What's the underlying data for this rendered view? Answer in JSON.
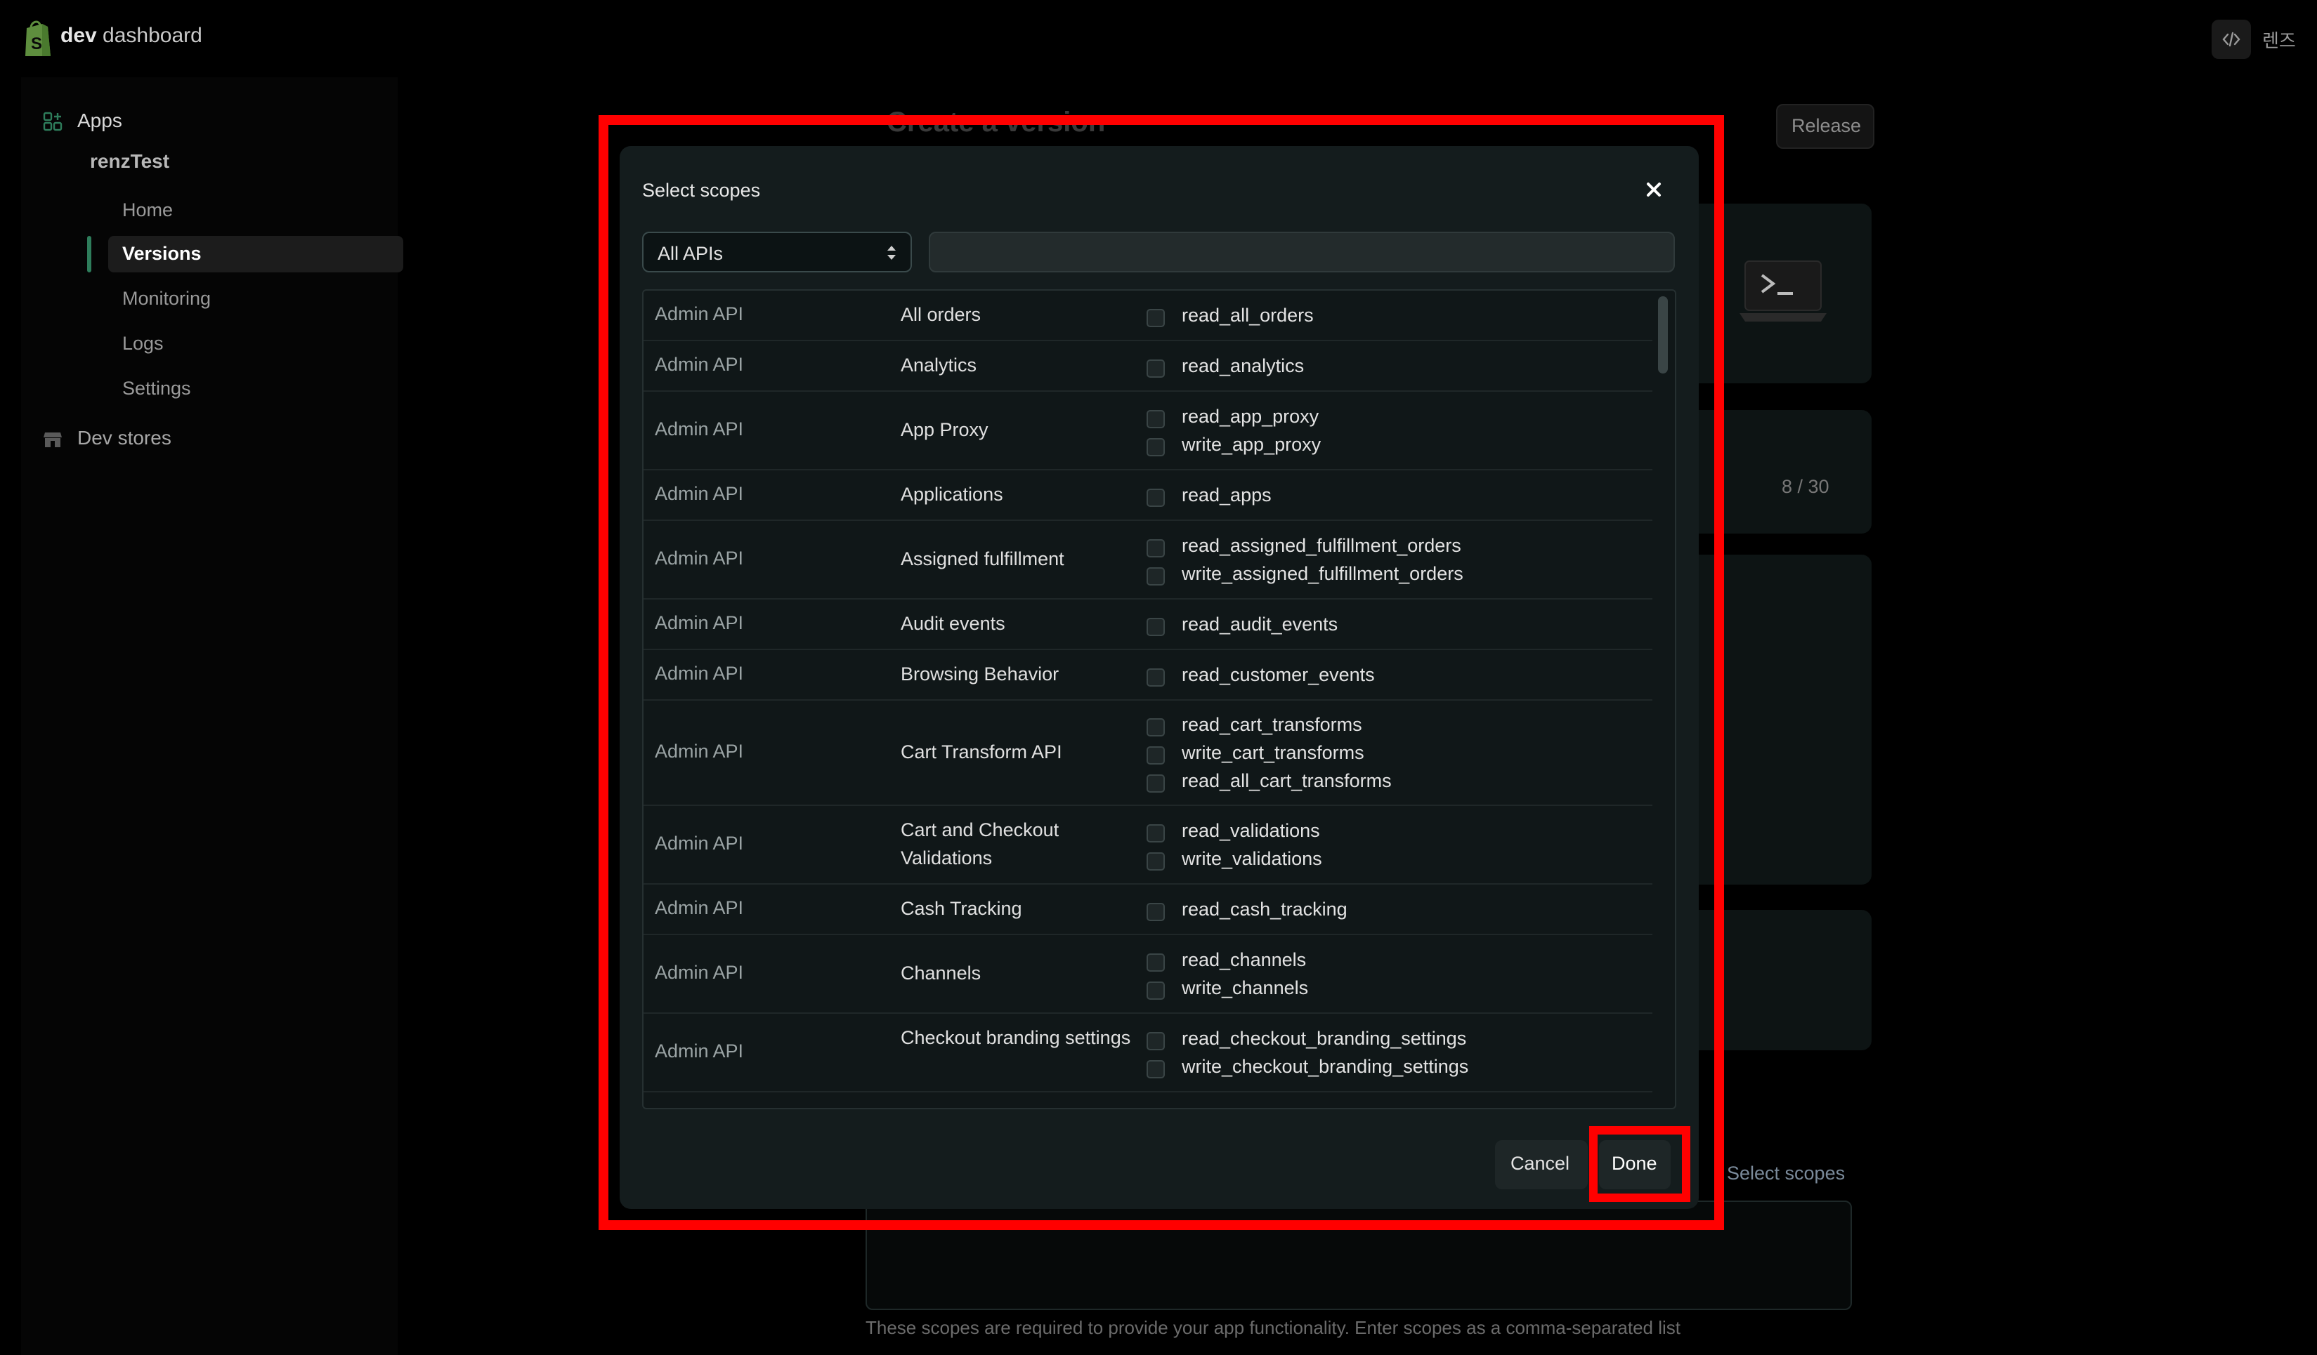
{
  "header": {
    "brand_bold": "dev",
    "brand_rest": "dashboard",
    "user": "렌즈"
  },
  "sidebar": {
    "apps_label": "Apps",
    "app_name": "renzTest",
    "items": [
      {
        "label": "Home"
      },
      {
        "label": "Versions"
      },
      {
        "label": "Monitoring"
      },
      {
        "label": "Logs"
      },
      {
        "label": "Settings"
      }
    ],
    "dev_stores_label": "Dev stores"
  },
  "page": {
    "title": "Create a version",
    "release_label": "Release",
    "counter": "8 / 30",
    "select_scopes_link": "Select scopes",
    "help_text": "These scopes are required to provide your app functionality. Enter scopes as a comma-separated list"
  },
  "modal": {
    "title": "Select scopes",
    "api_filter": "All APIs",
    "search_value": "",
    "cancel_label": "Cancel",
    "done_label": "Done",
    "rows": [
      {
        "api": "Admin API",
        "name": "All orders",
        "scopes": [
          "read_all_orders"
        ]
      },
      {
        "api": "Admin API",
        "name": "Analytics",
        "scopes": [
          "read_analytics"
        ]
      },
      {
        "api": "Admin API",
        "name": "App Proxy",
        "scopes": [
          "read_app_proxy",
          "write_app_proxy"
        ]
      },
      {
        "api": "Admin API",
        "name": "Applications",
        "scopes": [
          "read_apps"
        ]
      },
      {
        "api": "Admin API",
        "name": "Assigned fulfillment",
        "scopes": [
          "read_assigned_fulfillment_orders",
          "write_assigned_fulfillment_orders"
        ]
      },
      {
        "api": "Admin API",
        "name": "Audit events",
        "scopes": [
          "read_audit_events"
        ]
      },
      {
        "api": "Admin API",
        "name": "Browsing Behavior",
        "scopes": [
          "read_customer_events"
        ]
      },
      {
        "api": "Admin API",
        "name": "Cart Transform API",
        "scopes": [
          "read_cart_transforms",
          "write_cart_transforms",
          "read_all_cart_transforms"
        ]
      },
      {
        "api": "Admin API",
        "name": "Cart and Checkout Validations",
        "scopes": [
          "read_validations",
          "write_validations"
        ]
      },
      {
        "api": "Admin API",
        "name": "Cash Tracking",
        "scopes": [
          "read_cash_tracking"
        ]
      },
      {
        "api": "Admin API",
        "name": "Channels",
        "scopes": [
          "read_channels",
          "write_channels"
        ]
      },
      {
        "api": "Admin API",
        "name": "Checkout branding settings",
        "scopes": [
          "read_checkout_branding_settings",
          "write_checkout_branding_settings"
        ]
      }
    ]
  },
  "colors": {
    "highlight": "#ff0000",
    "accent": "#2e7d5b"
  }
}
